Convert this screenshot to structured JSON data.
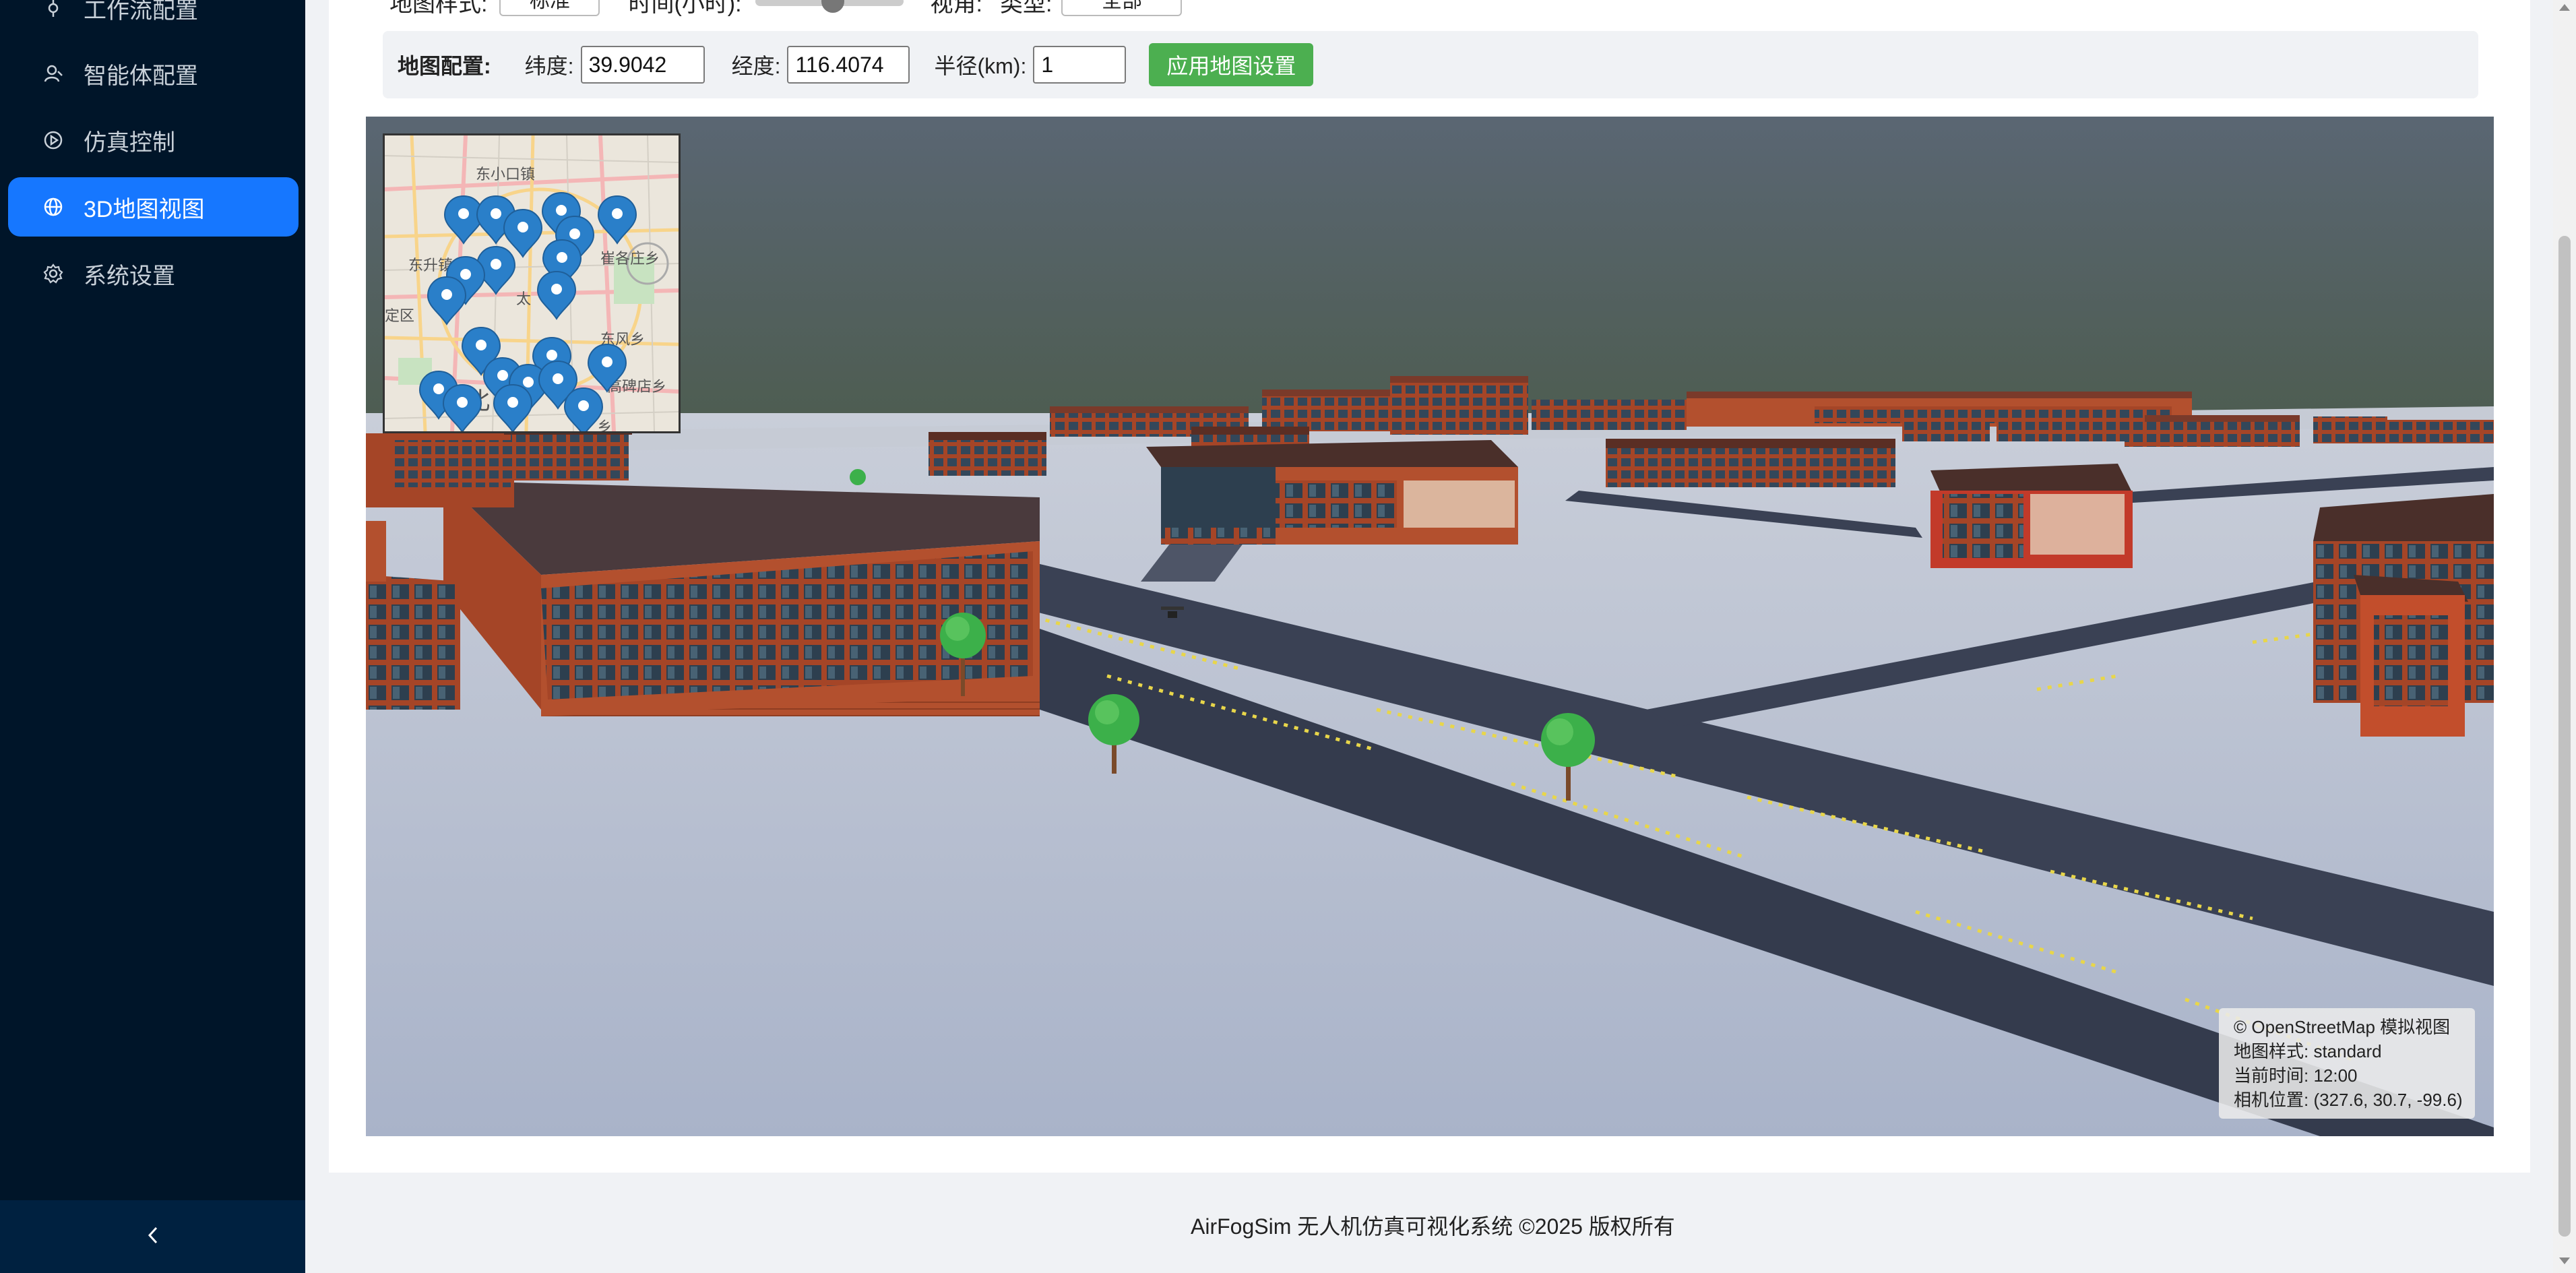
{
  "sidebar": {
    "items": [
      {
        "label": "工作流配置",
        "icon": "workflow-icon"
      },
      {
        "label": "智能体配置",
        "icon": "agent-icon"
      },
      {
        "label": "仿真控制",
        "icon": "play-circle-icon"
      },
      {
        "label": "3D地图视图",
        "icon": "globe-icon",
        "active": true
      },
      {
        "label": "系统设置",
        "icon": "gear-icon"
      }
    ],
    "collapse_icon": "chevron-left-icon",
    "colors": {
      "background": "#001529",
      "active": "#1677ff",
      "collapse_bg": "#002140"
    }
  },
  "toolbar": {
    "style_label": "地图样式:",
    "style_value": "标准",
    "time_label": "时间(小时):",
    "time_slider_level": 0.5,
    "clipped_label": "视角:",
    "type_label": "类型:",
    "type_value": "全部"
  },
  "map_config": {
    "title": "地图配置:",
    "lat_label": "纬度:",
    "lat_value": "39.9042",
    "lng_label": "经度:",
    "lng_value": "116.4074",
    "radius_label": "半径(km):",
    "radius_value": "1",
    "apply_label": "应用地图设置",
    "apply_color": "#4caf50"
  },
  "minimap": {
    "labels": [
      "东小口镇",
      "东升镇",
      "崔各庄乡",
      "太",
      "东风乡",
      "定区",
      "北",
      "乡",
      "高碑店乡"
    ],
    "marker_color": "#2a7fc9"
  },
  "info_overlay": {
    "line1": "© OpenStreetMap 模拟视图",
    "line2": "地图样式: standard",
    "line3": "当前时间: 12:00",
    "line4": "相机位置: (327.6, 30.7, -99.6)"
  },
  "footer": {
    "text": "AirFogSim 无人机仿真可视化系统 ©2025 版权所有"
  }
}
